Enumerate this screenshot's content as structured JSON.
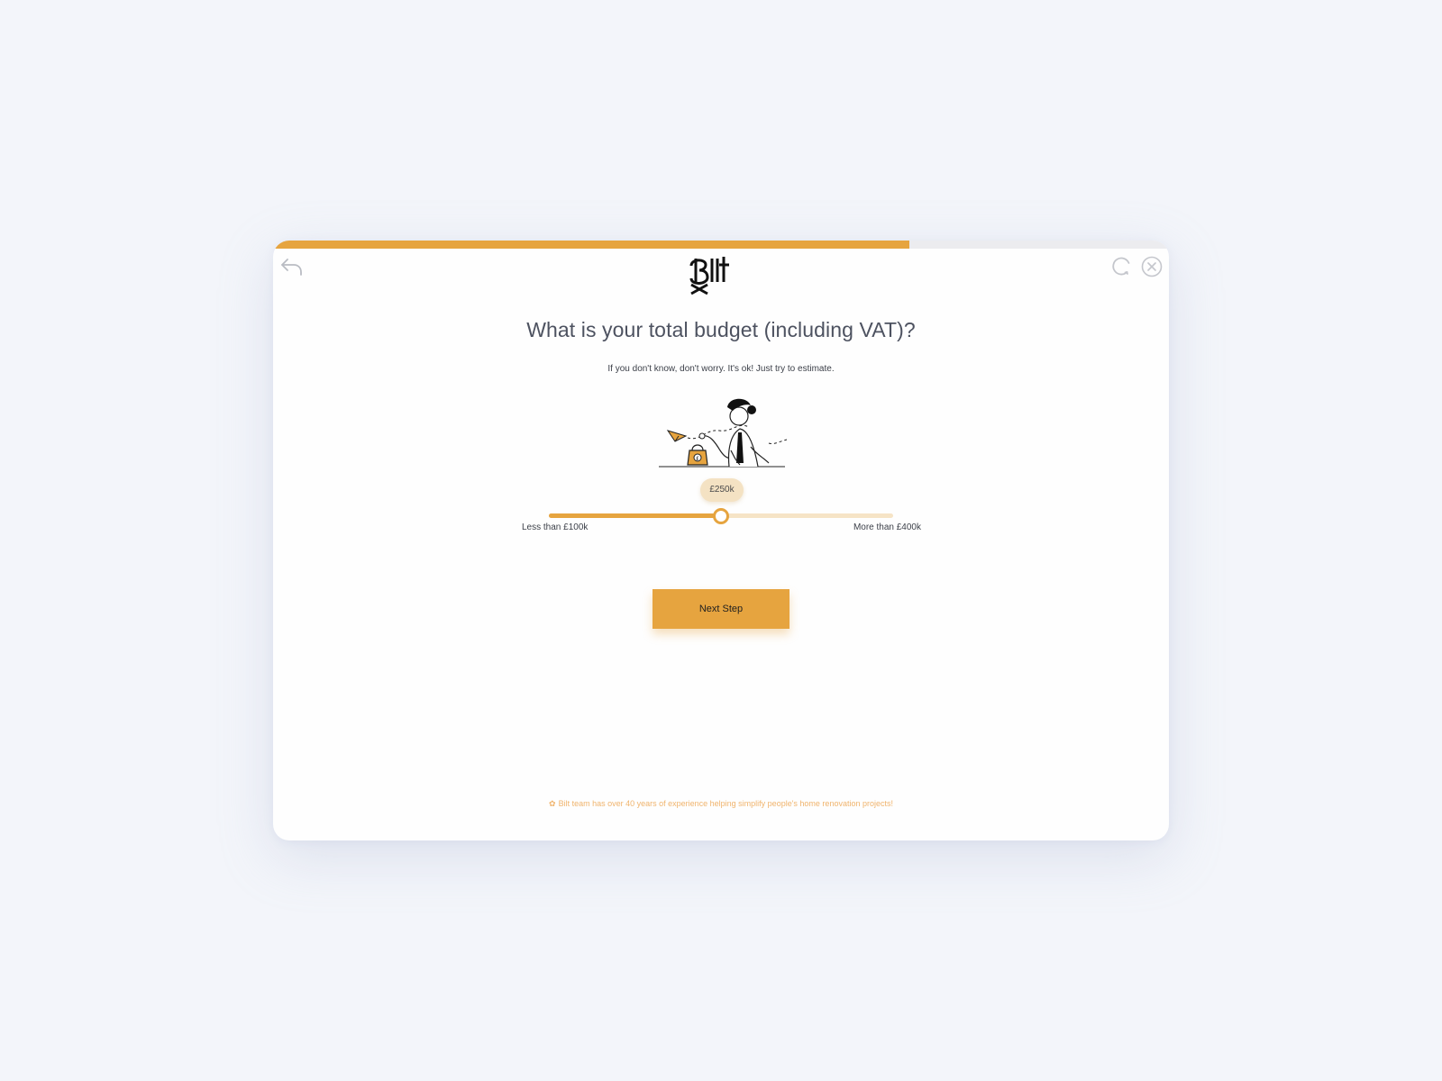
{
  "progress": {
    "value_percent": 71
  },
  "header": {
    "back_icon": "undo-arrow-icon",
    "refresh_icon": "refresh-icon",
    "close_icon": "close-circle-icon",
    "logo_icon": "bilt-logo-icon"
  },
  "question": {
    "title": "What is your total budget (including VAT)?",
    "subtitle": "If you don't know, don't worry. It's ok! Just try to estimate."
  },
  "illustration": {
    "icon": "person-with-money-bag-illustration"
  },
  "budget_slider": {
    "current_label": "£250k",
    "value_fraction": 0.5,
    "min_label": "Less than £100k",
    "max_label": "More than £400k"
  },
  "actions": {
    "next_label": "Next Step"
  },
  "footer": {
    "star_icon": "star-icon",
    "star_glyph": "✿",
    "note": "Bilt team has over 40 years of experience helping simplify people's home renovation projects!"
  },
  "colors": {
    "accent": "#e6a43f",
    "accent_light": "#f6e4c6",
    "background": "#f3f5fa",
    "card": "#fefefe",
    "title_text": "#4d5260",
    "footer_text": "#f0b46d"
  }
}
